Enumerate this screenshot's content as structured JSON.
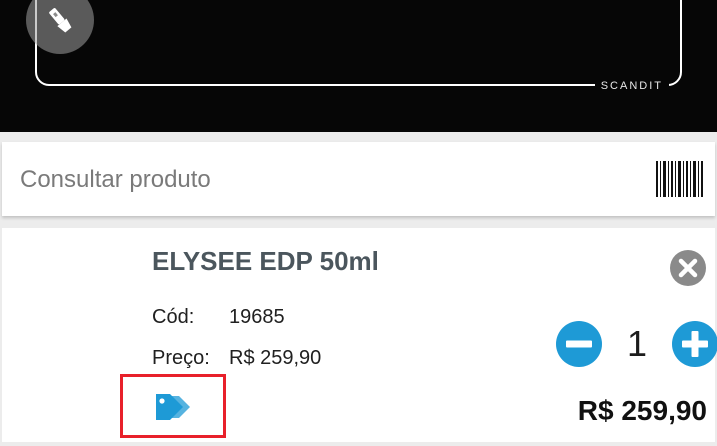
{
  "scanner": {
    "brand_label": "SCANDIT"
  },
  "search": {
    "placeholder": "Consultar produto",
    "value": ""
  },
  "product": {
    "name": "ELYSEE EDP 50ml",
    "code_label": "Cód:",
    "code_value": "19685",
    "price_label": "Preço:",
    "price_value": "R$ 259,90",
    "quantity": "1",
    "total": "R$ 259,90"
  },
  "colors": {
    "accent": "#1e9ad6",
    "remove": "#8a8a8a",
    "highlight": "#e8202a"
  },
  "icons": {
    "torch": "flashlight-icon",
    "barcode": "barcode-icon",
    "remove": "close-circle-icon",
    "minus": "minus-circle-icon",
    "plus": "plus-circle-icon",
    "tag": "price-tag-icon"
  }
}
